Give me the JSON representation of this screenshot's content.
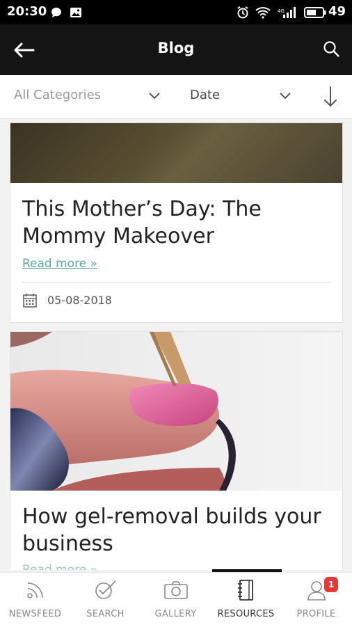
{
  "status_bar": {
    "time": "20:30",
    "battery": "49"
  },
  "header": {
    "title": "Blog"
  },
  "filters": {
    "category": "All Categories",
    "sort_field": "Date"
  },
  "posts": [
    {
      "title": "This Mother’s Day: The Mommy Makeover",
      "read_more": "Read more »",
      "date": "05-08-2018"
    },
    {
      "title": "How gel-removal builds your business",
      "read_more": "Read more »"
    }
  ],
  "bottom_nav": [
    {
      "label": "NEWSFEED"
    },
    {
      "label": "SEARCH"
    },
    {
      "label": "GALLERY"
    },
    {
      "label": "RESOURCES",
      "active": true
    },
    {
      "label": "PROFILE",
      "badge": "1"
    }
  ],
  "colors": {
    "accent_link": "#5aa9a0",
    "badge": "#e53935",
    "header_bg": "#141414"
  }
}
